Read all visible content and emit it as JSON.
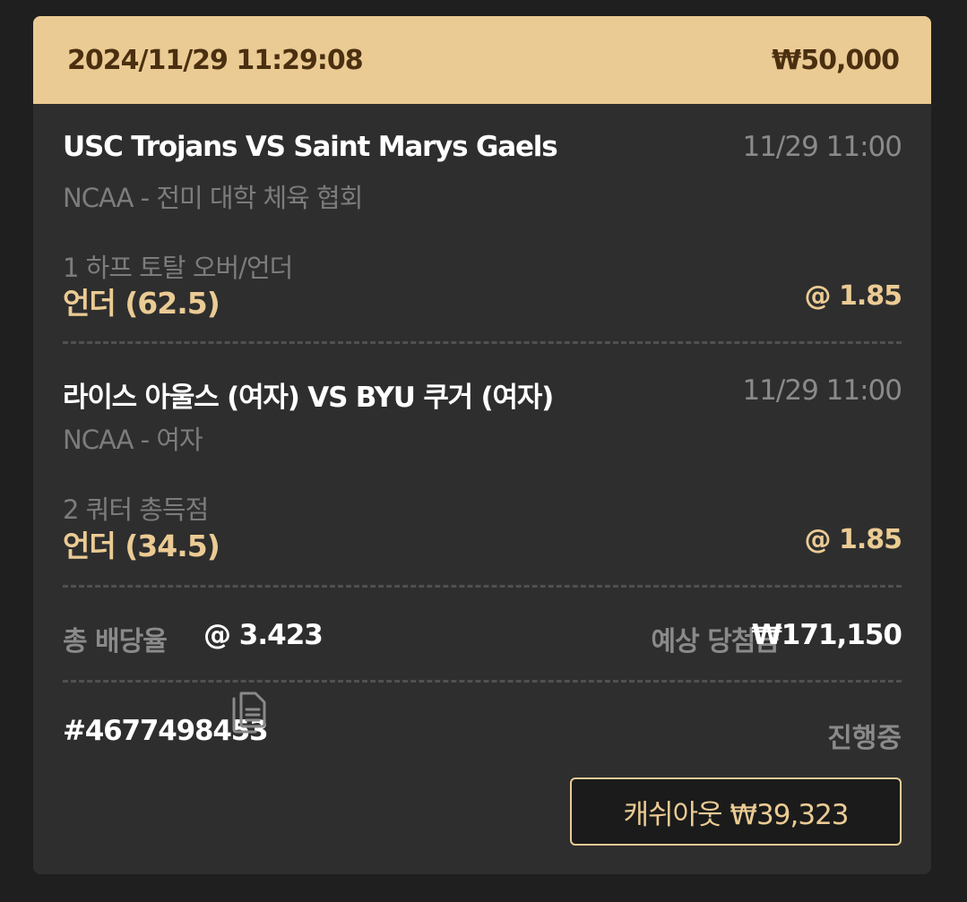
{
  "header": {
    "datetime": "2024/11/29 11:29:08",
    "stake": "₩50,000"
  },
  "bets": [
    {
      "title": "USC Trojans VS Saint Marys Gaels",
      "time": "11/29 11:00",
      "league": "NCAA - 전미 대학 체육 협회",
      "market": "1 하프 토탈 오버/언더",
      "pick": "언더 (62.5)",
      "odds": "@ 1.85"
    },
    {
      "title": "라이스 아울스 (여자) VS BYU 쿠거 (여자)",
      "time": "11/29 11:00",
      "league": "NCAA - 여자",
      "market": "2 쿼터 총득점",
      "pick": "언더 (34.5)",
      "odds": "@ 1.85"
    }
  ],
  "summary": {
    "total_odds_label": "총 배당율",
    "total_odds_value": "@ 3.423",
    "expected_win_label": "예상 당첨금",
    "expected_win_value": "₩171,150"
  },
  "ticket": {
    "id": "#4677498453",
    "copy_icon": "copy-icon",
    "status": "진행중"
  },
  "cashout": {
    "label": "캐쉬아웃 ₩39,323"
  },
  "colors": {
    "accent": "#ebcb94",
    "card_bg": "#2e2e2e",
    "page_bg": "#1f1f1f"
  }
}
